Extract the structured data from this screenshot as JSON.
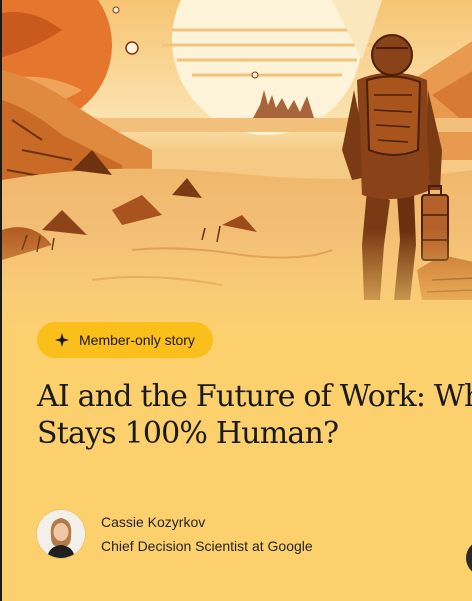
{
  "badge": {
    "label": "Member-only story",
    "icon": "sparkle-star-icon",
    "color": "#fbbf1b"
  },
  "article": {
    "title_line1": "AI and the Future of Work: What",
    "title_line2": "Stays 100% Human?"
  },
  "author": {
    "name": "Cassie Kozyrkov",
    "role": "Chief Decision Scientist at Google",
    "avatar": "author-avatar"
  },
  "hero": {
    "image": "astronaut-desert-illustration"
  },
  "colors": {
    "background": "#fdd06e",
    "accent": "#fbbf1b",
    "text": "#1a1a1a"
  }
}
